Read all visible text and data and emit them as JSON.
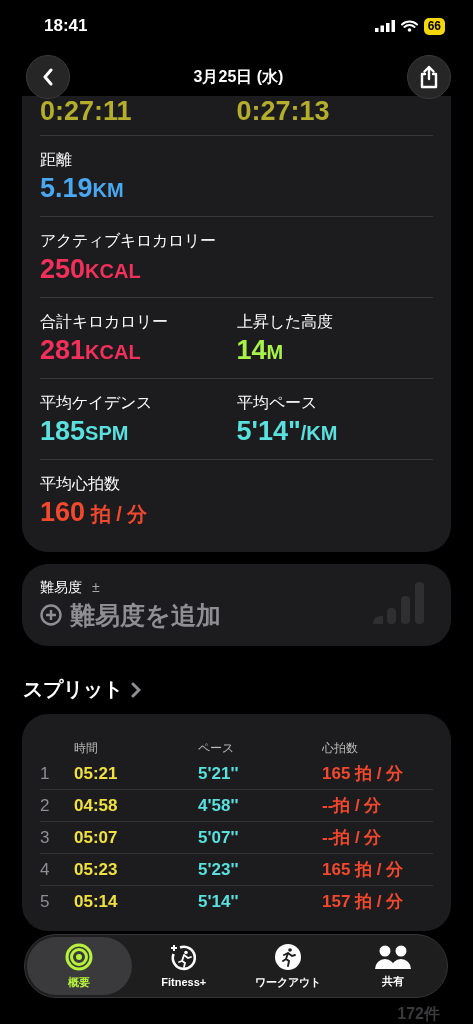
{
  "status_bar": {
    "time": "18:41",
    "battery": "66"
  },
  "nav": {
    "title": "3月25日 (水)"
  },
  "summary": {
    "times": [
      {
        "value": "0:27:11",
        "color": "#b5ad2c"
      },
      {
        "value": "0:27:13",
        "color": "#b5ad2c"
      }
    ],
    "rows": [
      [
        {
          "label": "距離",
          "value": "5.19",
          "unit": "KM",
          "color": "#4aa8f2"
        }
      ],
      [
        {
          "label": "アクティブキロカロリー",
          "value": "250",
          "unit": "KCAL",
          "color": "#f2305a"
        }
      ],
      [
        {
          "label": "合計キロカロリー",
          "value": "281",
          "unit": "KCAL",
          "color": "#f2305a"
        },
        {
          "label": "上昇した高度",
          "value": "14",
          "unit": "M",
          "color": "#a8f24a"
        }
      ],
      [
        {
          "label": "平均ケイデンス",
          "value": "185",
          "unit": "SPM",
          "color": "#5ae0de"
        },
        {
          "label": "平均ペース",
          "value": "5'14\"",
          "unit": "/KM",
          "color": "#5ae0de"
        }
      ],
      [
        {
          "label": "平均心拍数",
          "value": "160",
          "unit": " 拍 / 分",
          "color": "#f2482e"
        }
      ]
    ]
  },
  "difficulty": {
    "label": "難易度",
    "sign": "±",
    "action": "難易度を追加"
  },
  "splits": {
    "title": "スプリット",
    "columns": [
      "時間",
      "ペース",
      "心拍数"
    ],
    "rows": [
      {
        "index": "1",
        "time": "05:21",
        "pace": "5'21''",
        "heart_rate": "165 拍 / 分"
      },
      {
        "index": "2",
        "time": "04:58",
        "pace": "4'58''",
        "heart_rate": "--拍 / 分"
      },
      {
        "index": "3",
        "time": "05:07",
        "pace": "5'07''",
        "heart_rate": "--拍 / 分"
      },
      {
        "index": "4",
        "time": "05:23",
        "pace": "5'23''",
        "heart_rate": "165 拍 / 分"
      },
      {
        "index": "5",
        "time": "05:14",
        "pace": "5'14''",
        "heart_rate": "157 拍 / 分"
      }
    ]
  },
  "tabs": [
    {
      "label": "概要",
      "selected": true
    },
    {
      "label": "Fitness+",
      "selected": false
    },
    {
      "label": "ワークアウト",
      "selected": false
    },
    {
      "label": "共有",
      "selected": false
    }
  ],
  "footer_count": "172件"
}
